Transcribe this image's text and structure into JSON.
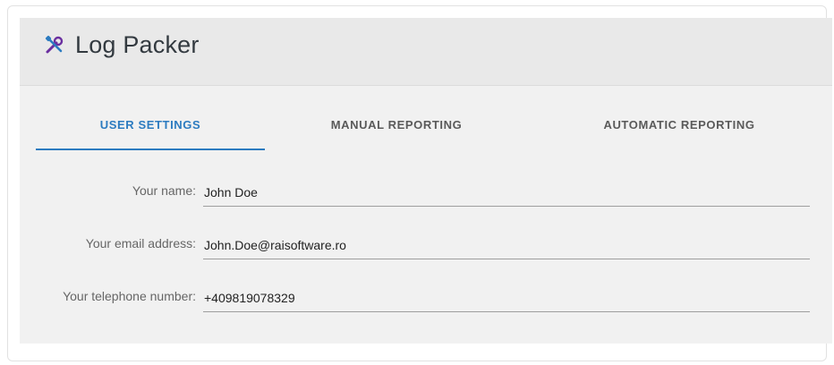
{
  "app": {
    "title": "Log Packer",
    "icon": "tools-icon",
    "accent_color": "#2c7bc0"
  },
  "tabs": [
    {
      "label": "USER SETTINGS",
      "active": true
    },
    {
      "label": "MANUAL REPORTING",
      "active": false
    },
    {
      "label": "AUTOMATIC REPORTING",
      "active": false
    }
  ],
  "form": {
    "name": {
      "label": "Your name:",
      "value": "John Doe"
    },
    "email": {
      "label": "Your email address:",
      "value": "John.Doe@raisoftware.ro"
    },
    "phone": {
      "label": "Your telephone number:",
      "value": "+409819078329"
    }
  }
}
